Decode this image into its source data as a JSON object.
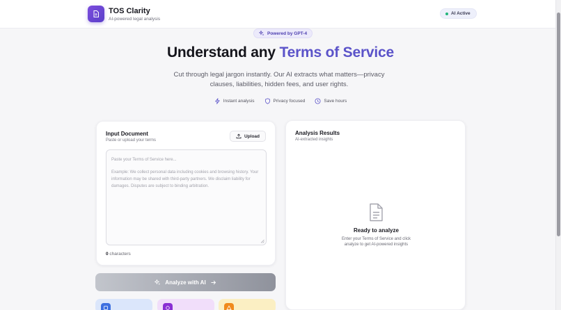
{
  "header": {
    "app_name": "TOS Clarity",
    "tagline": "AI-powered legal analysis",
    "status": "AI Active",
    "logo_icon": "document-icon"
  },
  "hero": {
    "badge": "Powered by GPT-4",
    "title_prefix": "Understand any ",
    "title_accent": "Terms of Service",
    "description": "Cut through legal jargon instantly. Our AI extracts what matters—privacy clauses, liabilities, hidden fees, and user rights.",
    "features": [
      {
        "label": "Instant analysis",
        "icon": "lightning-icon"
      },
      {
        "label": "Privacy focused",
        "icon": "shield-icon"
      },
      {
        "label": "Save hours",
        "icon": "clock-icon"
      }
    ]
  },
  "input_card": {
    "title": "Input Document",
    "subtitle": "Paste or upload your terms",
    "upload_label": "Upload",
    "placeholder_line1": "Paste your Terms of Service here...",
    "placeholder_example": "Example: We collect personal data including cookies and browsing history. Your information may be shared with third-party partners. We disclaim liability for damages. Disputes are subject to binding arbitration.",
    "char_count": "0",
    "char_label": " characters"
  },
  "results_card": {
    "title": "Analysis Results",
    "subtitle": "AI-extracted insights",
    "empty_title": "Ready to analyze",
    "empty_desc": "Enter your Terms of Service and click analyze to get AI-powered insights"
  },
  "analyze_button": {
    "label": "Analyze with AI",
    "disabled": true
  },
  "colors": {
    "accent": "#5b53c9",
    "brand_gradient_start": "#7c4ddd",
    "status_green": "#22b57a",
    "button_disabled": "#a7aab2"
  },
  "scroll": {
    "position_fraction": 0.04,
    "visible_fraction": 0.72
  }
}
